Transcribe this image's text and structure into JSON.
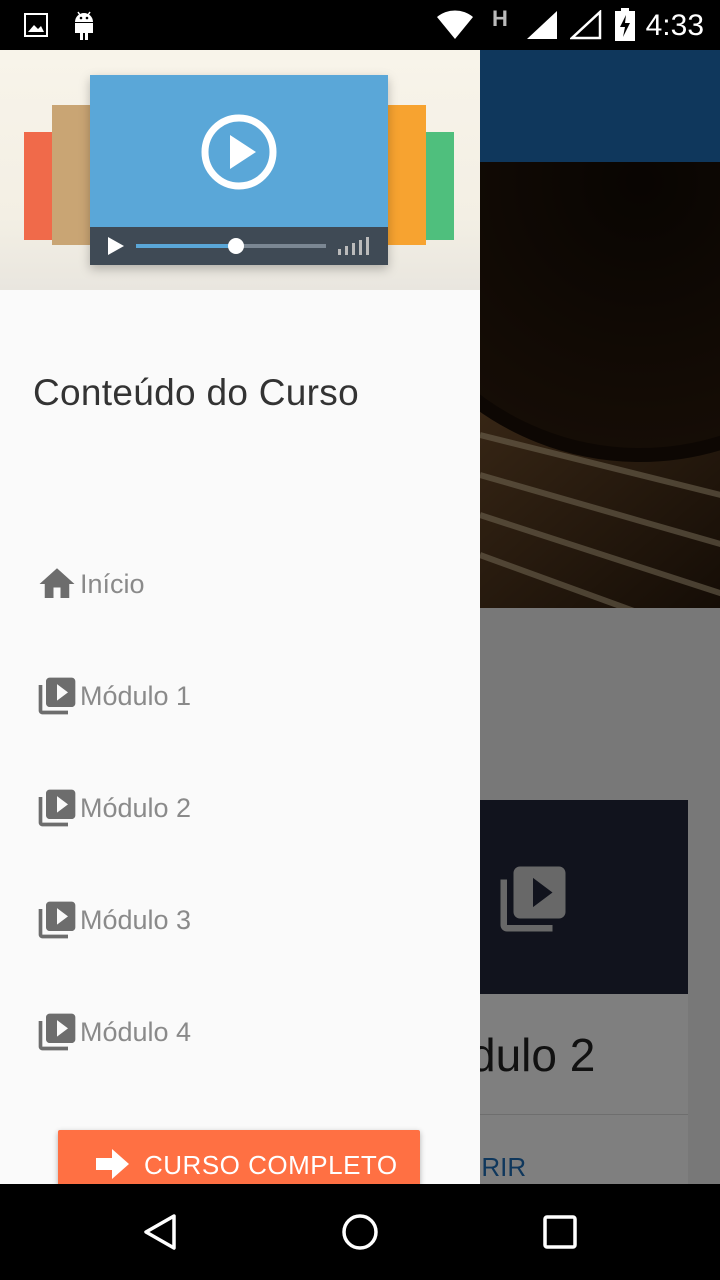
{
  "status_bar": {
    "time": "4:33",
    "network_letter": "H",
    "icons": [
      "image-icon",
      "android-icon",
      "wifi-icon",
      "signal-icon",
      "signal-empty-icon",
      "battery-charging-icon"
    ]
  },
  "background_app": {
    "card_title": "dulo 2",
    "card_action": "BRIR",
    "toolbar_color": "#1f6fb8"
  },
  "drawer": {
    "header_image": "video-player-illustration",
    "course_title": "Conteúdo do Curso",
    "items": [
      {
        "label": "Início",
        "icon": "home-icon"
      },
      {
        "label": "Módulo 1",
        "icon": "video-library-icon"
      },
      {
        "label": "Módulo 2",
        "icon": "video-library-icon"
      },
      {
        "label": "Módulo 3",
        "icon": "video-library-icon"
      },
      {
        "label": "Módulo 4",
        "icon": "video-library-icon"
      }
    ],
    "cta": {
      "label": "CURSO COMPLETO",
      "icon": "arrow-right-icon",
      "color": "#ff7043"
    }
  },
  "navigation_bar": {
    "buttons": [
      "back-icon",
      "home-circle-icon",
      "recents-icon"
    ]
  }
}
